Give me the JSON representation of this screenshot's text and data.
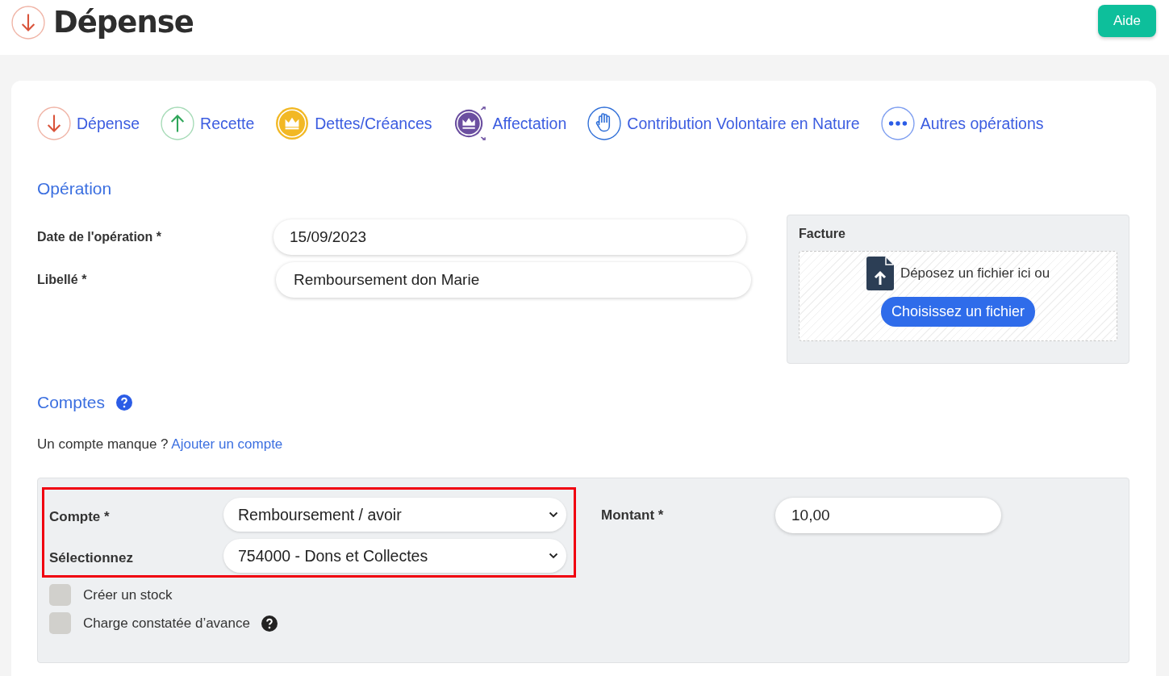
{
  "header": {
    "title": "Dépense",
    "help_button": "Aide"
  },
  "operation_types": [
    {
      "kind": "expense",
      "label": "Dépense"
    },
    {
      "kind": "income",
      "label": "Recette"
    },
    {
      "kind": "debt",
      "label": "Dettes/Créances"
    },
    {
      "kind": "allocation",
      "label": "Affectation"
    },
    {
      "kind": "contribution",
      "label": "Contribution Volontaire en Nature"
    },
    {
      "kind": "more",
      "label": "Autres opérations"
    }
  ],
  "operation": {
    "heading": "Opération",
    "fields": [
      {
        "label": "Date de l'opération *",
        "value": "15/09/2023"
      },
      {
        "label": "Libellé *",
        "value": "Remboursement don Marie"
      }
    ],
    "invoice": {
      "title": "Facture",
      "drop_text": "Déposez un fichier ici ou",
      "button": "Choisissez un fichier"
    }
  },
  "accounts": {
    "heading": "Comptes",
    "missing_text": "Un compte manque ?",
    "add_link": "Ajouter un compte",
    "highlighted": true,
    "selects": [
      {
        "label": "Compte *",
        "value": "Remboursement / avoir"
      },
      {
        "label": "Sélectionnez",
        "value": "754000 - Dons et Collectes"
      }
    ],
    "amount": {
      "label": "Montant *",
      "value": "10,00"
    },
    "checkboxes": [
      {
        "label": "Créer un stock",
        "checked": false,
        "help": false
      },
      {
        "label": "Charge constatée d’avance",
        "checked": false,
        "help": true
      }
    ]
  }
}
